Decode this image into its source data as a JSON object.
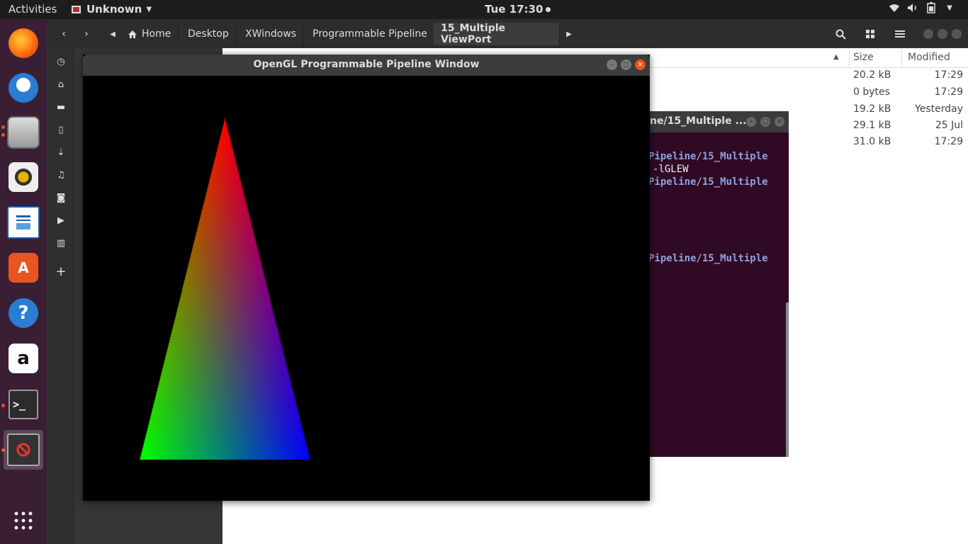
{
  "topbar": {
    "activities": "Activities",
    "app_name": "Unknown",
    "clock": "Tue 17:30"
  },
  "dock": {
    "apps": [
      "firefox-icon",
      "thunderbird-icon",
      "files-icon",
      "rhythmbox-icon",
      "writer-icon",
      "software-icon",
      "help-icon",
      "amazon-icon",
      "terminal-icon",
      "opengl-app-icon",
      "show-apps-icon"
    ]
  },
  "files": {
    "breadcrumbs": [
      "Home",
      "Desktop",
      "XWindows",
      "Programmable Pipeline",
      "15_Multiple ViewPort"
    ],
    "columns": {
      "size": "Size",
      "modified": "Modified"
    },
    "rows": [
      {
        "size": "20.2 kB",
        "modified": "17:29"
      },
      {
        "size": "0 bytes",
        "modified": "17:29"
      },
      {
        "size": "19.2 kB",
        "modified": "Yesterday"
      },
      {
        "size": "29.1 kB",
        "modified": "25 Jul"
      },
      {
        "size": "31.0 kB",
        "modified": "17:29"
      }
    ]
  },
  "terminal": {
    "title": "ne/15_Multiple ...",
    "lines": [
      "Pipeline/15_Multiple",
      "-lGLEW",
      "Pipeline/15_Multiple",
      "Pipeline/15_Multiple"
    ]
  },
  "gl_window": {
    "title": "OpenGL Programmable Pipeline Window"
  },
  "colors": {
    "top_vertex": "#ff0000",
    "left_vertex": "#00ff00",
    "right_vertex": "#0000ff",
    "accent": "#e95420"
  }
}
